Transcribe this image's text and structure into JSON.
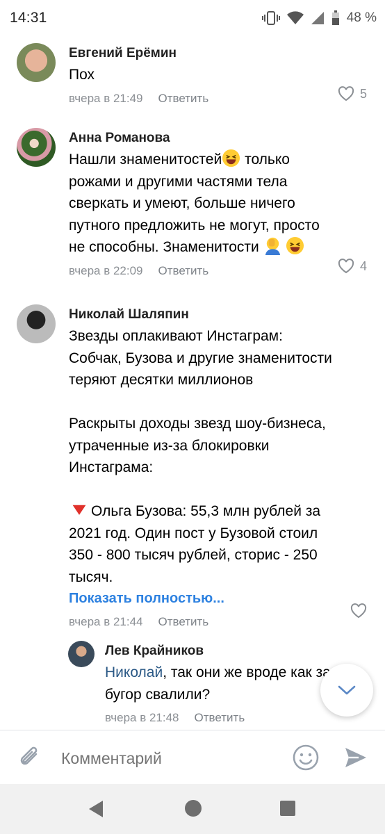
{
  "status": {
    "time": "14:31",
    "battery": "48 %"
  },
  "comments": [
    {
      "author": "Евгений Ерёмин",
      "text": [
        "Пох"
      ],
      "time": "вчера в 21:49",
      "reply": "Ответить",
      "likes": "5"
    },
    {
      "author": "Анна Романова",
      "text": [
        "Нашли знаменитостей",
        "только",
        "рожами и другими частями тела",
        "сверкать и умеют, больше ничего",
        "путного предложить не могут, просто",
        "не способны. Знаменитости"
      ],
      "time": "вчера в 22:09",
      "reply": "Ответить",
      "likes": "4"
    },
    {
      "author": "Николай Шаляпин",
      "text": [
        "Звезды оплакивают Инстаграм:",
        "Собчак, Бузова и другие знаменитости",
        "теряют десятки миллионов",
        "",
        "Раскрыты доходы звезд шоу-бизнеса,",
        "утраченные из-за блокировки",
        "Инстаграма:",
        "",
        "Ольга Бузова: 55,3 млн рублей за",
        "2021 год. Один пост у Бузовой стоил",
        "350 - 800 тысяч рублей, сторис - 250",
        "тысяч."
      ],
      "show_more": "Показать полностью...",
      "time": "вчера в 21:44",
      "reply": "Ответить",
      "likes": ""
    },
    {
      "author": "Лев Крайников",
      "mention": "Николай",
      "text": [
        ", так они же вроде как за",
        "бугор свалили?"
      ],
      "time": "вчера в 21:48",
      "reply": "Ответить"
    }
  ],
  "composer": {
    "placeholder": "Комментарий"
  },
  "icons": {
    "attach": "paperclip-icon",
    "emoji": "smile-icon",
    "send": "send-icon",
    "like": "heart-icon",
    "scroll": "chevron-down-icon"
  },
  "colors": {
    "link": "#2d81e0",
    "meta": "#8b8f94",
    "navbar": "#f1f1f1"
  }
}
